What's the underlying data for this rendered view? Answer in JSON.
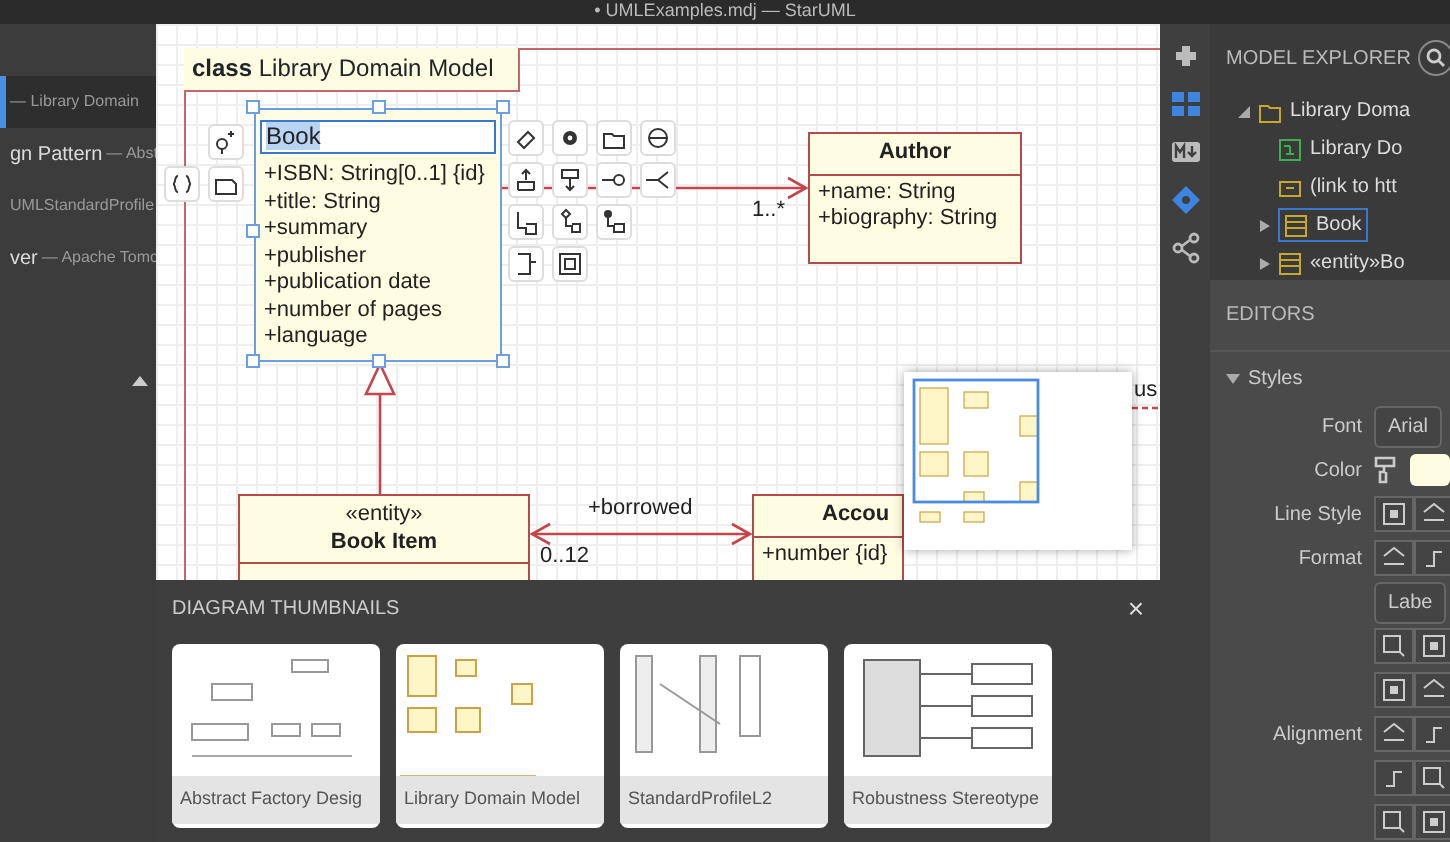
{
  "window": {
    "title": "• UMLExamples.mdj — StarUML"
  },
  "working_diagrams": [
    {
      "detail": "— Library Domain",
      "selected": true
    },
    {
      "name": "gn Pattern",
      "detail": "— Abst",
      "selected": false
    },
    {
      "detail": "UMLStandardProfile",
      "selected": false
    },
    {
      "name": "ver",
      "detail": "— Apache Tomc",
      "selected": false
    }
  ],
  "diagram": {
    "frame": {
      "keyword": "class",
      "name": "Library Domain Model"
    },
    "classes": [
      {
        "name": "Book",
        "editing": true,
        "attributes": [
          "+ISBN: String[0..1] {id}",
          "+title: String",
          "+summary",
          "+publisher",
          "+publication date",
          "+number of pages",
          "+language"
        ]
      },
      {
        "name": "Author",
        "editing": false,
        "attributes": [
          "+name: String",
          "+biography: String"
        ]
      },
      {
        "stereotype": "«entity»",
        "name": "Book Item",
        "editing": false
      },
      {
        "name": "Accou",
        "editing": false,
        "attributes": [
          "+number {id}"
        ]
      }
    ],
    "labels": [
      "1..*",
      "+borrowed",
      "0..12",
      "us"
    ]
  },
  "thumbnails": {
    "title": "DIAGRAM THUMBNAILS",
    "close": "×",
    "items": [
      {
        "caption": "Abstract Factory Desig"
      },
      {
        "caption": "Library Domain Model"
      },
      {
        "caption": "StandardProfileL2"
      },
      {
        "caption": "Robustness Stereotype"
      }
    ]
  },
  "model_explorer": {
    "title": "MODEL EXPLORER",
    "tree": [
      {
        "label": "Library Doma",
        "kind": "model",
        "expanded": true,
        "selected": false,
        "children": [
          {
            "label": "Library Do",
            "kind": "diagram",
            "selected": false
          },
          {
            "label": "(link to htt",
            "kind": "link",
            "selected": false
          },
          {
            "label": "Book",
            "kind": "class",
            "expanded": false,
            "selected": true
          },
          {
            "label": "«entity»Bo",
            "kind": "class",
            "expanded": false,
            "selected": false
          }
        ]
      }
    ]
  },
  "editors": {
    "title": "EDITORS",
    "section": {
      "label": "Styles",
      "expanded": true
    },
    "rows": [
      {
        "label": "Font",
        "kind": "select",
        "value": "Arial"
      },
      {
        "label": "Color",
        "kind": "color"
      },
      {
        "label": "Line Style",
        "kind": "buttons"
      },
      {
        "label": "Format",
        "kind": "buttons"
      },
      {
        "kind": "select",
        "value": "Labe"
      },
      {
        "kind": "buttons"
      },
      {
        "kind": "buttons"
      },
      {
        "label": "Alignment",
        "kind": "buttons"
      },
      {
        "kind": "buttons"
      },
      {
        "kind": "buttons"
      }
    ]
  }
}
